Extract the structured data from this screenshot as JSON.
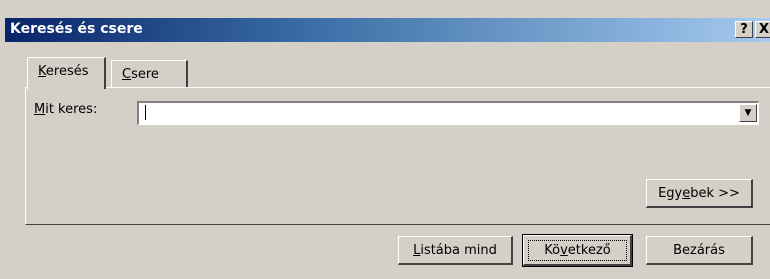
{
  "window": {
    "title": "Keresés és csere",
    "help_label": "?",
    "close_label": "X"
  },
  "tabs": [
    {
      "label_mnemonic": "K",
      "label_rest": "eresés",
      "active": true
    },
    {
      "label_mnemonic": "C",
      "label_rest": "sere",
      "active": false
    }
  ],
  "find": {
    "label_mnemonic": "M",
    "label_rest": "it keres:",
    "value": "",
    "dropdown_arrow": "▼"
  },
  "buttons": {
    "more": {
      "pre": "Egy",
      "mnemonic": "e",
      "post": "bek >>"
    },
    "list_all": {
      "pre": "",
      "mnemonic": "L",
      "post": "istába mind"
    },
    "next": {
      "pre": "Kö",
      "mnemonic": "v",
      "post": "etkező"
    },
    "close": {
      "label": "Bezárás"
    }
  },
  "colors": {
    "face": "#d4d0c8",
    "title_start": "#0a246a",
    "title_end": "#a6caf0"
  }
}
